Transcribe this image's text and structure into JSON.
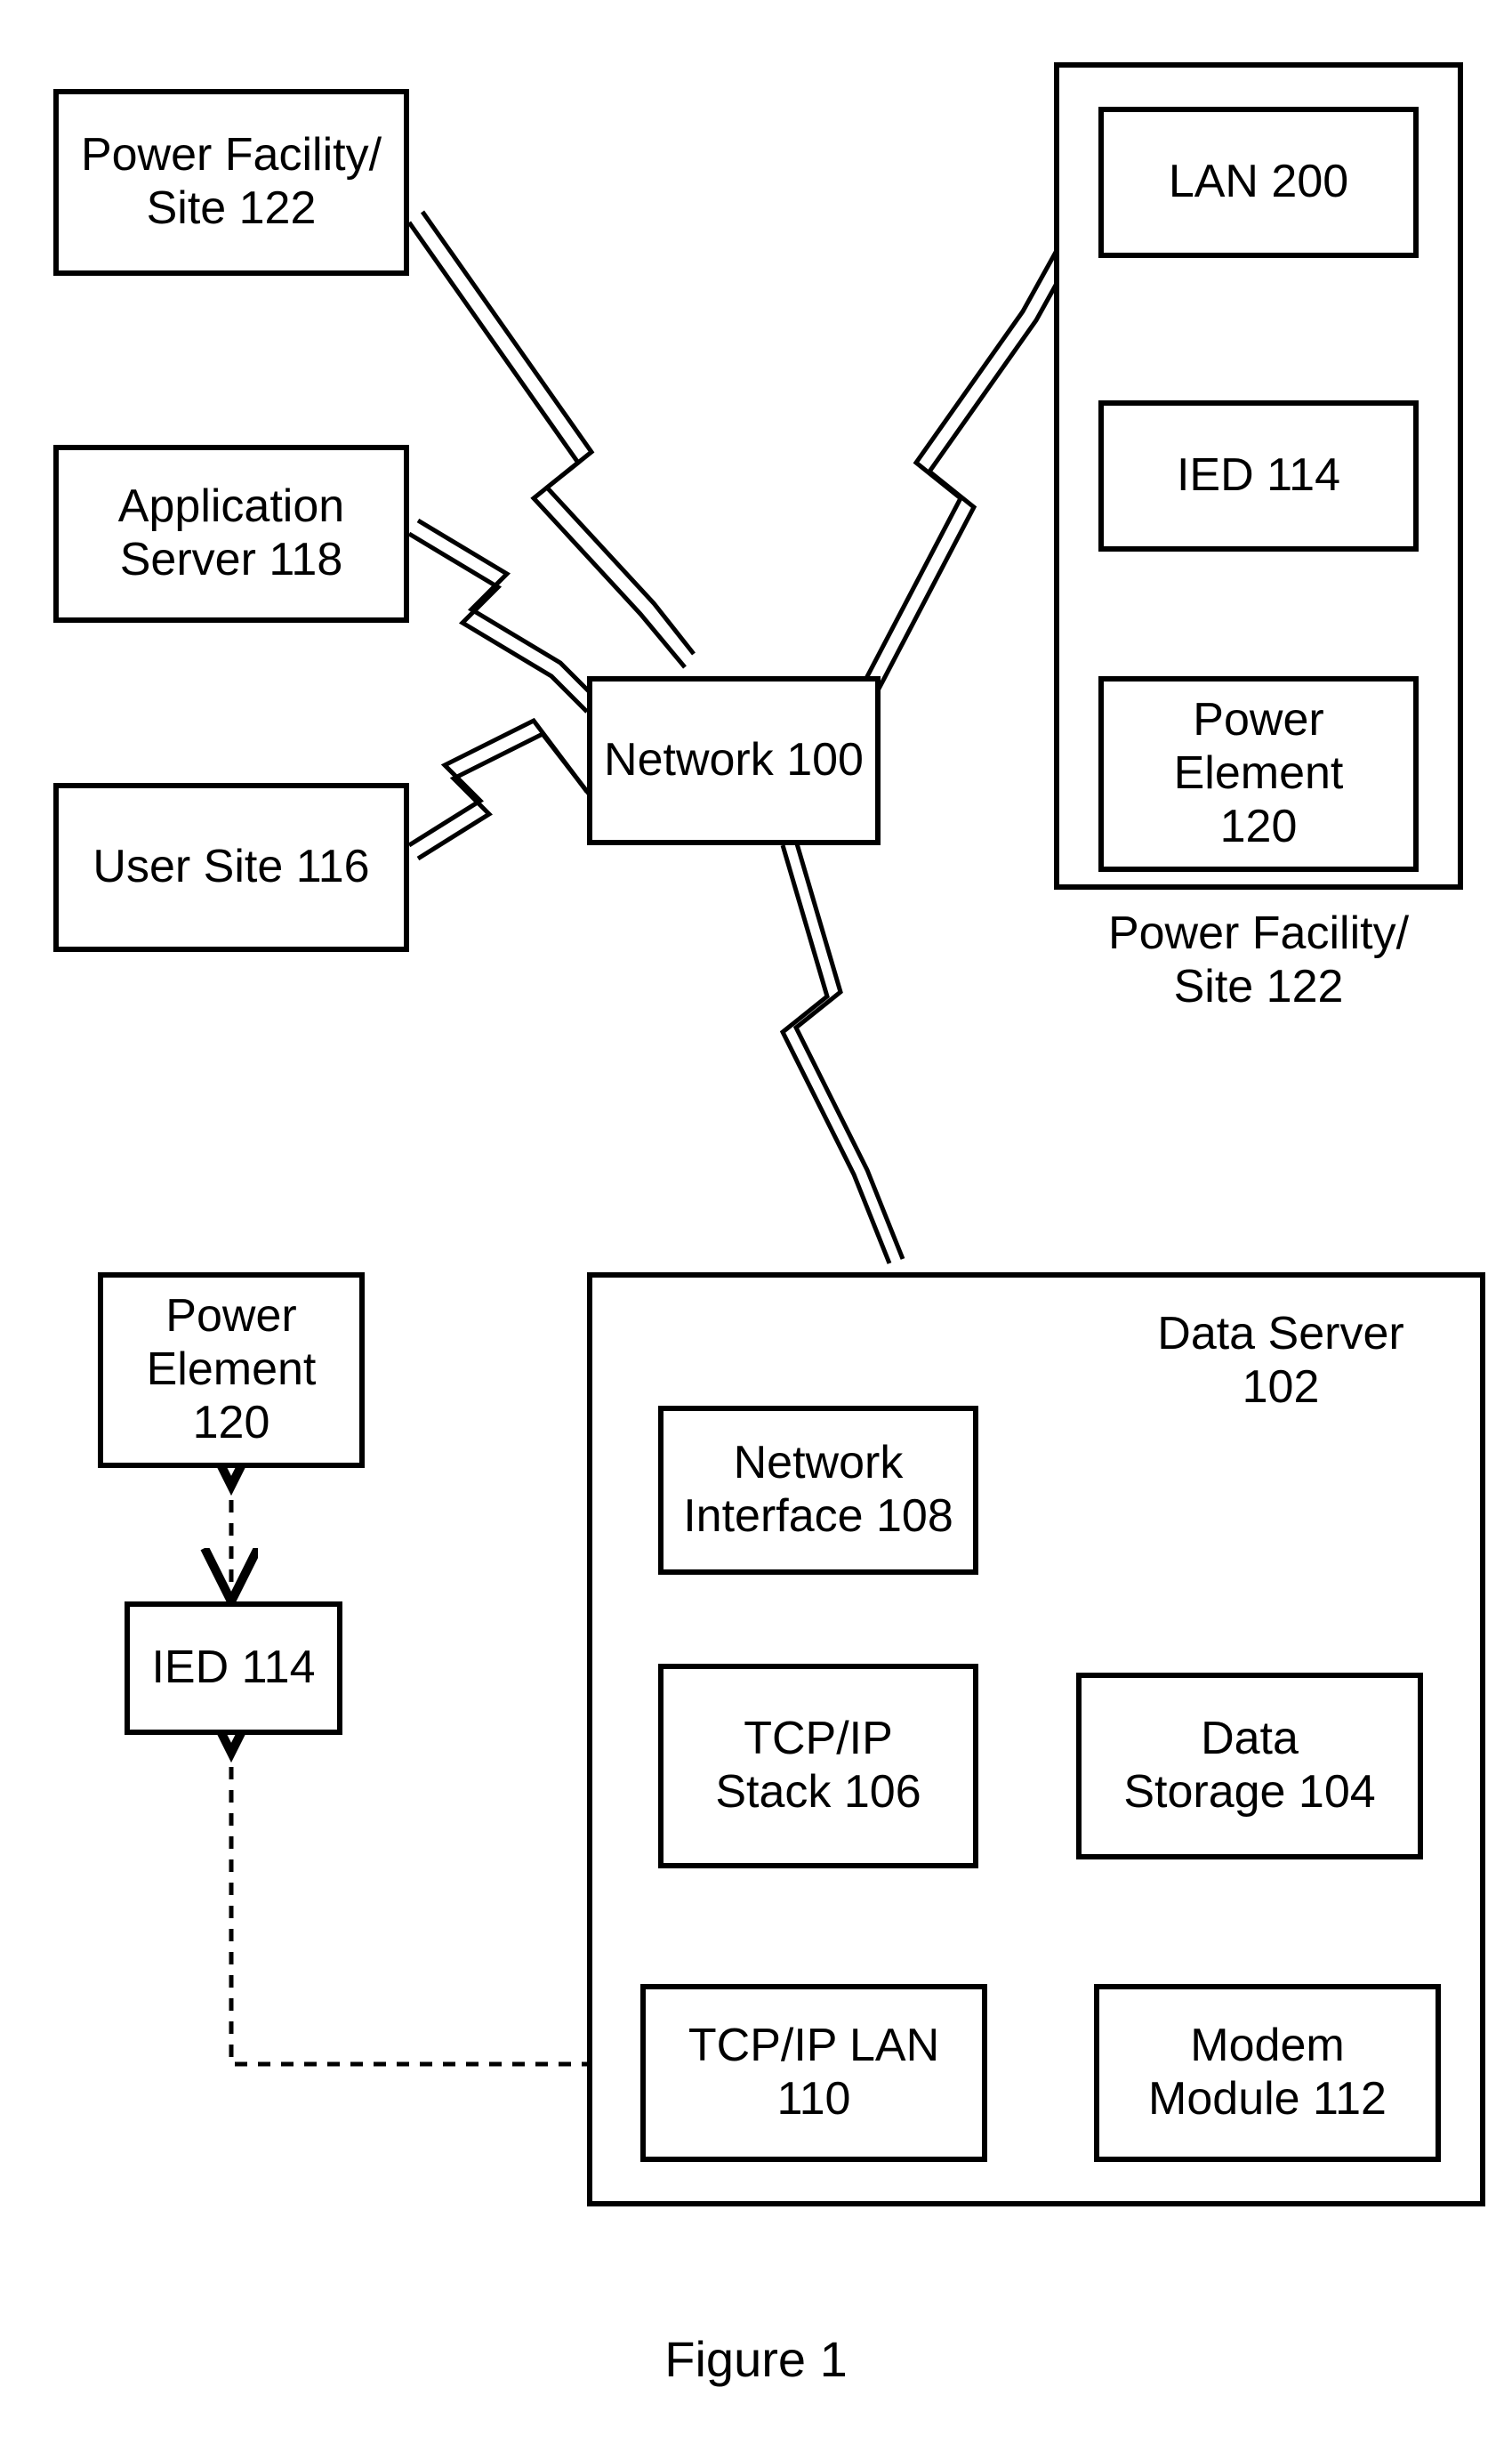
{
  "figure_caption": "Figure 1",
  "nodes": {
    "power_facility_site_left": "Power Facility/\nSite 122",
    "application_server": "Application\nServer 118",
    "user_site": "User Site 116",
    "network": "Network 100",
    "lan": "LAN 200",
    "ied_right": "IED 114",
    "power_element_right": "Power\nElement\n120",
    "power_facility_site_label": "Power Facility/\nSite 122",
    "power_element_left": "Power\nElement\n120",
    "ied_left": "IED 114",
    "data_server_label": "Data Server\n102",
    "network_interface": "Network\nInterface 108",
    "tcpip_stack": "TCP/IP\nStack 106",
    "data_storage": "Data\nStorage 104",
    "tcpip_lan": "TCP/IP LAN\n110",
    "modem_module": "Modem\nModule 112"
  }
}
